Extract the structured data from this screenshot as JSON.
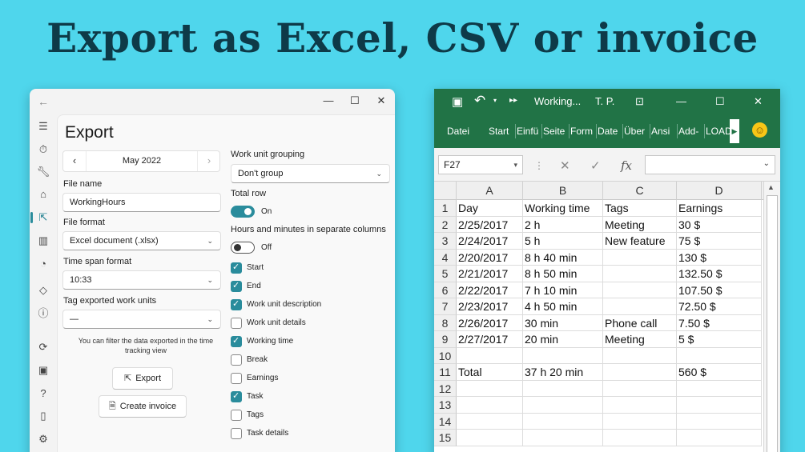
{
  "headline": "Export as Excel, CSV or invoice",
  "app": {
    "title": "Export",
    "nav": {
      "prev": "‹",
      "next": "›",
      "month": "May 2022"
    },
    "file_name": {
      "label": "File name",
      "value": "WorkingHours"
    },
    "file_format": {
      "label": "File format",
      "value": "Excel document (.xlsx)"
    },
    "time_span_format": {
      "label": "Time span format",
      "value": "10:33"
    },
    "tag_exported": {
      "label": "Tag exported work units",
      "value": "—"
    },
    "hint": "You can filter the data exported in the time tracking view",
    "export_button": "Export",
    "invoice_button": "Create invoice",
    "grouping": {
      "label": "Work unit grouping",
      "value": "Don't group"
    },
    "total_row": {
      "label": "Total row",
      "state": "On",
      "checked": true
    },
    "separate_columns": {
      "label": "Hours and minutes in separate columns",
      "state": "Off",
      "checked": false
    },
    "columns": [
      {
        "label": "Start",
        "checked": true
      },
      {
        "label": "End",
        "checked": true
      },
      {
        "label": "Work unit description",
        "checked": true
      },
      {
        "label": "Work unit details",
        "checked": false
      },
      {
        "label": "Working time",
        "checked": true
      },
      {
        "label": "Break",
        "checked": false
      },
      {
        "label": "Earnings",
        "checked": false
      },
      {
        "label": "Task",
        "checked": true
      },
      {
        "label": "Tags",
        "checked": false
      },
      {
        "label": "Task details",
        "checked": false
      }
    ]
  },
  "excel": {
    "title": "Working...",
    "user": "T. P.",
    "tabs": [
      "Datei",
      "Start",
      "Einfü",
      "Seite",
      "Form",
      "Date",
      "Über",
      "Ansi",
      "Add-",
      "LOAD"
    ],
    "namebox": "F27",
    "fx": "fx",
    "col_headers": [
      "A",
      "B",
      "C",
      "D"
    ],
    "rows": [
      {
        "n": "1",
        "cells": [
          "Day",
          "Working time",
          "Tags",
          "Earnings"
        ]
      },
      {
        "n": "2",
        "cells": [
          "2/25/2017",
          "2 h",
          "Meeting",
          "30 $"
        ]
      },
      {
        "n": "3",
        "cells": [
          "2/24/2017",
          "5 h",
          "New feature",
          "75 $"
        ]
      },
      {
        "n": "4",
        "cells": [
          "2/20/2017",
          "8 h 40 min",
          "",
          "130 $"
        ]
      },
      {
        "n": "5",
        "cells": [
          "2/21/2017",
          "8 h 50 min",
          "",
          "132.50 $"
        ]
      },
      {
        "n": "6",
        "cells": [
          "2/22/2017",
          "7 h 10 min",
          "",
          "107.50 $"
        ]
      },
      {
        "n": "7",
        "cells": [
          "2/23/2017",
          "4 h 50 min",
          "",
          "72.50 $"
        ]
      },
      {
        "n": "8",
        "cells": [
          "2/26/2017",
          "30 min",
          "Phone call",
          "7.50 $"
        ]
      },
      {
        "n": "9",
        "cells": [
          "2/27/2017",
          "20 min",
          "Meeting",
          "5 $"
        ]
      },
      {
        "n": "10",
        "cells": [
          "",
          "",
          "",
          ""
        ]
      },
      {
        "n": "11",
        "cells": [
          "Total",
          "37 h 20 min",
          "",
          "560 $"
        ]
      },
      {
        "n": "12",
        "cells": [
          "",
          "",
          "",
          ""
        ]
      },
      {
        "n": "13",
        "cells": [
          "",
          "",
          "",
          ""
        ]
      },
      {
        "n": "14",
        "cells": [
          "",
          "",
          "",
          ""
        ]
      },
      {
        "n": "15",
        "cells": [
          "",
          "",
          "",
          ""
        ]
      }
    ]
  }
}
